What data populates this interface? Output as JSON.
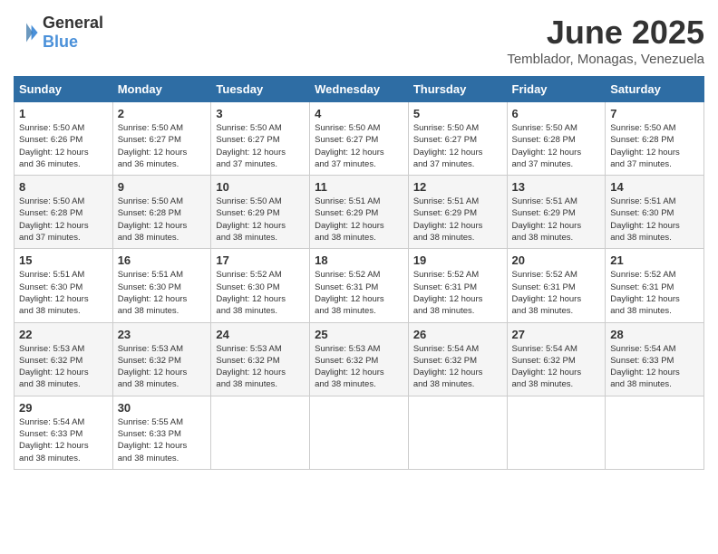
{
  "logo": {
    "text_general": "General",
    "text_blue": "Blue"
  },
  "title": "June 2025",
  "location": "Temblador, Monagas, Venezuela",
  "headers": [
    "Sunday",
    "Monday",
    "Tuesday",
    "Wednesday",
    "Thursday",
    "Friday",
    "Saturday"
  ],
  "weeks": [
    [
      {
        "day": "1",
        "sunrise": "5:50 AM",
        "sunset": "6:26 PM",
        "daylight": "12 hours and 36 minutes."
      },
      {
        "day": "2",
        "sunrise": "5:50 AM",
        "sunset": "6:27 PM",
        "daylight": "12 hours and 36 minutes."
      },
      {
        "day": "3",
        "sunrise": "5:50 AM",
        "sunset": "6:27 PM",
        "daylight": "12 hours and 37 minutes."
      },
      {
        "day": "4",
        "sunrise": "5:50 AM",
        "sunset": "6:27 PM",
        "daylight": "12 hours and 37 minutes."
      },
      {
        "day": "5",
        "sunrise": "5:50 AM",
        "sunset": "6:27 PM",
        "daylight": "12 hours and 37 minutes."
      },
      {
        "day": "6",
        "sunrise": "5:50 AM",
        "sunset": "6:28 PM",
        "daylight": "12 hours and 37 minutes."
      },
      {
        "day": "7",
        "sunrise": "5:50 AM",
        "sunset": "6:28 PM",
        "daylight": "12 hours and 37 minutes."
      }
    ],
    [
      {
        "day": "8",
        "sunrise": "5:50 AM",
        "sunset": "6:28 PM",
        "daylight": "12 hours and 37 minutes."
      },
      {
        "day": "9",
        "sunrise": "5:50 AM",
        "sunset": "6:28 PM",
        "daylight": "12 hours and 38 minutes."
      },
      {
        "day": "10",
        "sunrise": "5:50 AM",
        "sunset": "6:29 PM",
        "daylight": "12 hours and 38 minutes."
      },
      {
        "day": "11",
        "sunrise": "5:51 AM",
        "sunset": "6:29 PM",
        "daylight": "12 hours and 38 minutes."
      },
      {
        "day": "12",
        "sunrise": "5:51 AM",
        "sunset": "6:29 PM",
        "daylight": "12 hours and 38 minutes."
      },
      {
        "day": "13",
        "sunrise": "5:51 AM",
        "sunset": "6:29 PM",
        "daylight": "12 hours and 38 minutes."
      },
      {
        "day": "14",
        "sunrise": "5:51 AM",
        "sunset": "6:30 PM",
        "daylight": "12 hours and 38 minutes."
      }
    ],
    [
      {
        "day": "15",
        "sunrise": "5:51 AM",
        "sunset": "6:30 PM",
        "daylight": "12 hours and 38 minutes."
      },
      {
        "day": "16",
        "sunrise": "5:51 AM",
        "sunset": "6:30 PM",
        "daylight": "12 hours and 38 minutes."
      },
      {
        "day": "17",
        "sunrise": "5:52 AM",
        "sunset": "6:30 PM",
        "daylight": "12 hours and 38 minutes."
      },
      {
        "day": "18",
        "sunrise": "5:52 AM",
        "sunset": "6:31 PM",
        "daylight": "12 hours and 38 minutes."
      },
      {
        "day": "19",
        "sunrise": "5:52 AM",
        "sunset": "6:31 PM",
        "daylight": "12 hours and 38 minutes."
      },
      {
        "day": "20",
        "sunrise": "5:52 AM",
        "sunset": "6:31 PM",
        "daylight": "12 hours and 38 minutes."
      },
      {
        "day": "21",
        "sunrise": "5:52 AM",
        "sunset": "6:31 PM",
        "daylight": "12 hours and 38 minutes."
      }
    ],
    [
      {
        "day": "22",
        "sunrise": "5:53 AM",
        "sunset": "6:32 PM",
        "daylight": "12 hours and 38 minutes."
      },
      {
        "day": "23",
        "sunrise": "5:53 AM",
        "sunset": "6:32 PM",
        "daylight": "12 hours and 38 minutes."
      },
      {
        "day": "24",
        "sunrise": "5:53 AM",
        "sunset": "6:32 PM",
        "daylight": "12 hours and 38 minutes."
      },
      {
        "day": "25",
        "sunrise": "5:53 AM",
        "sunset": "6:32 PM",
        "daylight": "12 hours and 38 minutes."
      },
      {
        "day": "26",
        "sunrise": "5:54 AM",
        "sunset": "6:32 PM",
        "daylight": "12 hours and 38 minutes."
      },
      {
        "day": "27",
        "sunrise": "5:54 AM",
        "sunset": "6:32 PM",
        "daylight": "12 hours and 38 minutes."
      },
      {
        "day": "28",
        "sunrise": "5:54 AM",
        "sunset": "6:33 PM",
        "daylight": "12 hours and 38 minutes."
      }
    ],
    [
      {
        "day": "29",
        "sunrise": "5:54 AM",
        "sunset": "6:33 PM",
        "daylight": "12 hours and 38 minutes."
      },
      {
        "day": "30",
        "sunrise": "5:55 AM",
        "sunset": "6:33 PM",
        "daylight": "12 hours and 38 minutes."
      },
      null,
      null,
      null,
      null,
      null
    ]
  ]
}
